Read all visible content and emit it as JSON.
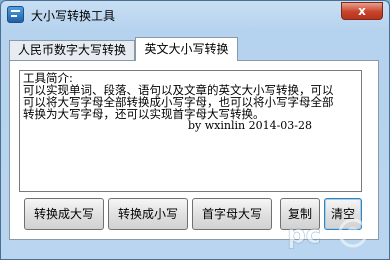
{
  "window": {
    "title": "大小写转换工具",
    "close_glyph": "x"
  },
  "tabs": [
    {
      "label": "人民币数字大写转换",
      "active": false
    },
    {
      "label": "英文大小写转换",
      "active": true
    }
  ],
  "editor": {
    "lines": [
      "工具简介:",
      "可以实现单词、段落、语句以及文章的英文大小写转换，可以",
      "可以将大写字母全部转换成小写字母，也可以将小写字母全部",
      "转换为大写字母，还可以实现首字母大写转换。",
      "by  wxinlin  2014-03-28"
    ]
  },
  "buttons": {
    "to_upper": "转换成大写",
    "to_lower": "转换成小写",
    "capitalize": "首字母大写",
    "copy": "复制",
    "clear": "清空"
  },
  "colors": {
    "close_button": "#c7432a",
    "window_frame": "#b9d5ef",
    "focus_border": "#3c7fb1"
  }
}
